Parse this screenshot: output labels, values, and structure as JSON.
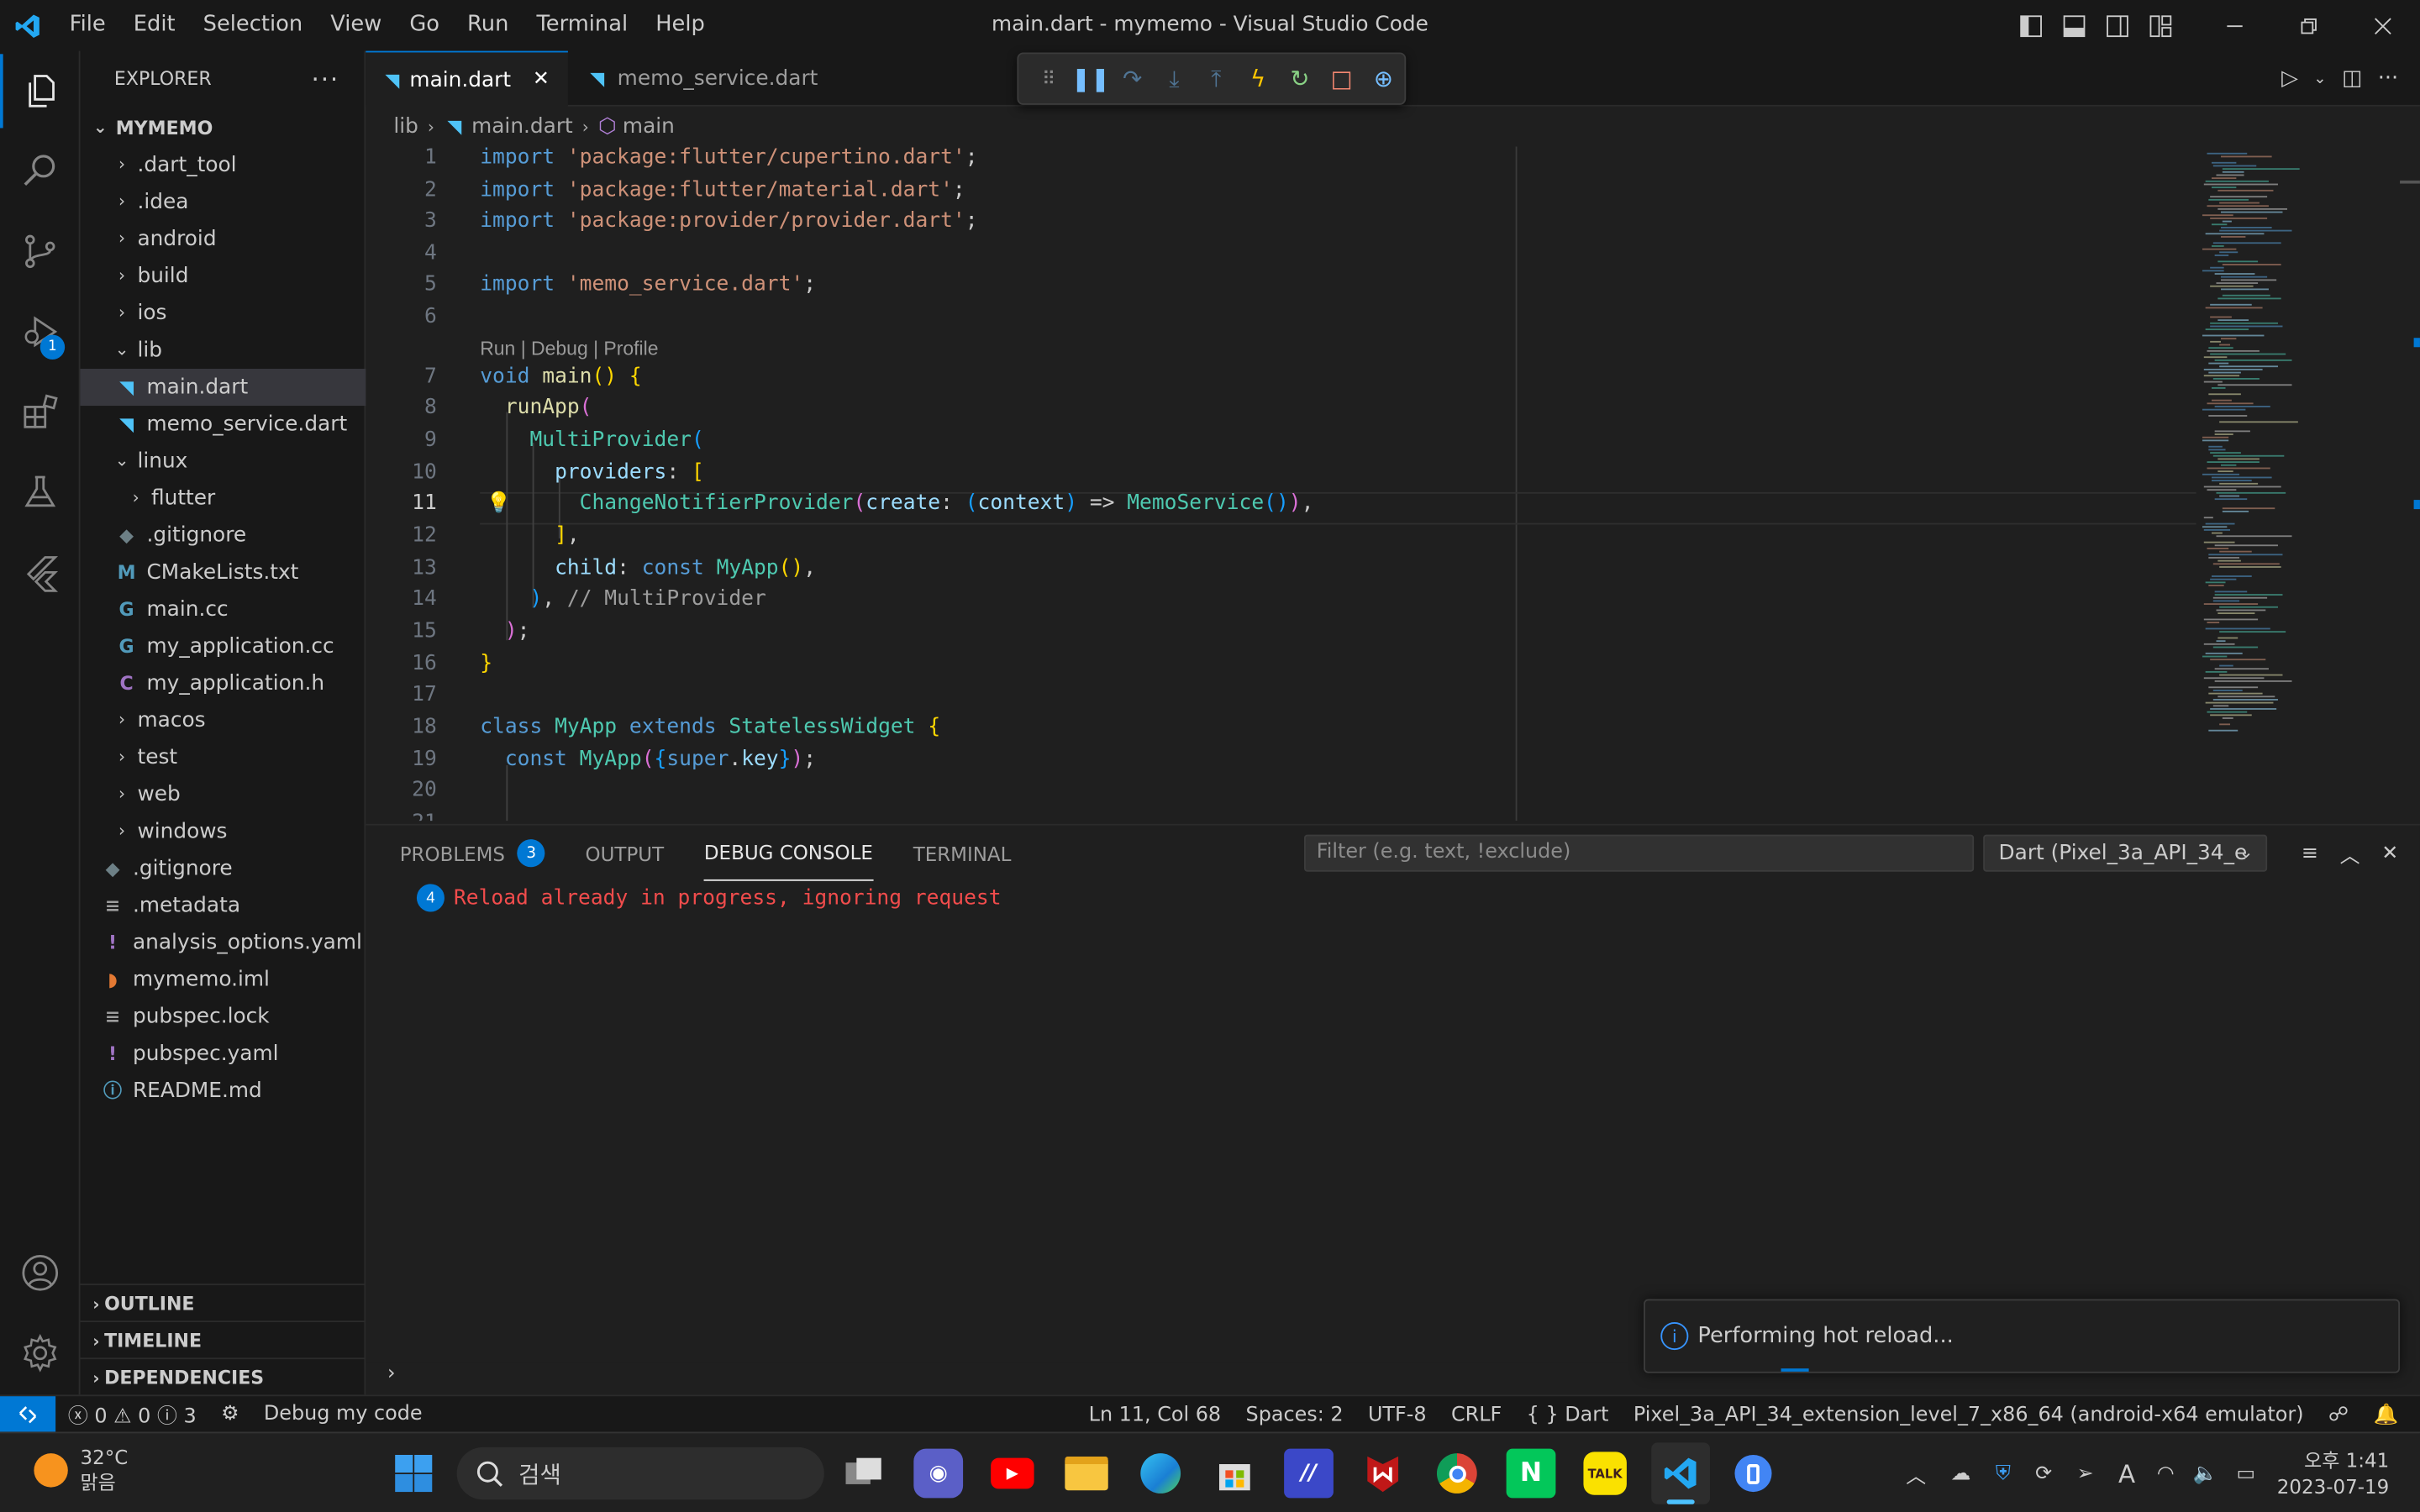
{
  "window": {
    "title": "main.dart - mymemo - Visual Studio Code"
  },
  "menu": [
    "File",
    "Edit",
    "Selection",
    "View",
    "Go",
    "Run",
    "Terminal",
    "Help"
  ],
  "activity": {
    "debug_badge": "1"
  },
  "explorer": {
    "title": "EXPLORER",
    "root": "MYMEMO",
    "items": [
      {
        "label": ".dart_tool",
        "type": "folder",
        "depth": 1
      },
      {
        "label": ".idea",
        "type": "folder",
        "depth": 1
      },
      {
        "label": "android",
        "type": "folder",
        "depth": 1
      },
      {
        "label": "build",
        "type": "folder",
        "depth": 1
      },
      {
        "label": "ios",
        "type": "folder",
        "depth": 1
      },
      {
        "label": "lib",
        "type": "folder-open",
        "depth": 1
      },
      {
        "label": "main.dart",
        "type": "dart",
        "depth": 2,
        "selected": true
      },
      {
        "label": "memo_service.dart",
        "type": "dart",
        "depth": 2
      },
      {
        "label": "linux",
        "type": "folder-open",
        "depth": 1
      },
      {
        "label": "flutter",
        "type": "folder",
        "depth": 2
      },
      {
        "label": ".gitignore",
        "type": "git",
        "depth": 2
      },
      {
        "label": "CMakeLists.txt",
        "type": "cmake",
        "depth": 2
      },
      {
        "label": "main.cc",
        "type": "cpp",
        "depth": 2
      },
      {
        "label": "my_application.cc",
        "type": "cpp",
        "depth": 2
      },
      {
        "label": "my_application.h",
        "type": "c",
        "depth": 2
      },
      {
        "label": "macos",
        "type": "folder",
        "depth": 1
      },
      {
        "label": "test",
        "type": "folder",
        "depth": 1
      },
      {
        "label": "web",
        "type": "folder",
        "depth": 1
      },
      {
        "label": "windows",
        "type": "folder",
        "depth": 1
      },
      {
        "label": ".gitignore",
        "type": "git",
        "depth": 1
      },
      {
        "label": ".metadata",
        "type": "lines",
        "depth": 1
      },
      {
        "label": "analysis_options.yaml",
        "type": "yaml",
        "depth": 1
      },
      {
        "label": "mymemo.iml",
        "type": "rss",
        "depth": 1
      },
      {
        "label": "pubspec.lock",
        "type": "lines",
        "depth": 1
      },
      {
        "label": "pubspec.yaml",
        "type": "yaml",
        "depth": 1
      },
      {
        "label": "README.md",
        "type": "info",
        "depth": 1
      }
    ],
    "sections": [
      "OUTLINE",
      "TIMELINE",
      "DEPENDENCIES"
    ]
  },
  "tabs": [
    {
      "label": "main.dart",
      "active": true
    },
    {
      "label": "memo_service.dart",
      "active": false
    }
  ],
  "breadcrumb": [
    "lib",
    "main.dart",
    "main"
  ],
  "code": {
    "codelens": "Run | Debug | Profile",
    "current_line": 11
  },
  "panel": {
    "tabs": [
      "PROBLEMS",
      "OUTPUT",
      "DEBUG CONSOLE",
      "TERMINAL"
    ],
    "problems_count": "3",
    "filter_placeholder": "Filter (e.g. text, !exclude)",
    "session": "Dart (Pixel_3a_API_34_e",
    "log_count": "4",
    "log_message": "Reload already in progress, ignoring request"
  },
  "toast": {
    "message": "Performing hot reload..."
  },
  "status": {
    "errors": "0",
    "warnings": "0",
    "infos": "3",
    "debug_label": "Debug my code",
    "position": "Ln 11, Col 68",
    "spaces": "Spaces: 2",
    "encoding": "UTF-8",
    "eol": "CRLF",
    "language": "Dart",
    "device": "Pixel_3a_API_34_extension_level_7_x86_64 (android-x64 emulator)"
  },
  "taskbar": {
    "temperature": "32°C",
    "weather": "맑음",
    "search": "검색",
    "time": "오후 1:41",
    "date": "2023-07-19"
  },
  "colors": {
    "accent": "#0078d4",
    "error": "#f14c4c"
  }
}
